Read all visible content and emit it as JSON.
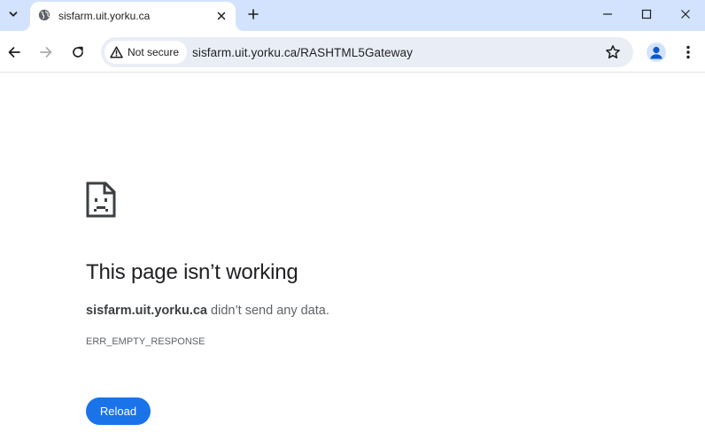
{
  "tab": {
    "title": "sisfarm.uit.yorku.ca",
    "favicon": "globe-icon"
  },
  "toolbar": {
    "security_label": "Not secure",
    "url": "sisfarm.uit.yorku.ca/RASHTML5Gateway"
  },
  "error": {
    "icon": "sad-page-icon",
    "title": "This page isn’t working",
    "host": "sisfarm.uit.yorku.ca",
    "message_suffix": " didn’t send any data.",
    "code": "ERR_EMPTY_RESPONSE",
    "reload_label": "Reload"
  },
  "colors": {
    "tabstrip": "#d3e3fd",
    "omnibox": "#e9eef6",
    "primary_button": "#1a73e8"
  }
}
